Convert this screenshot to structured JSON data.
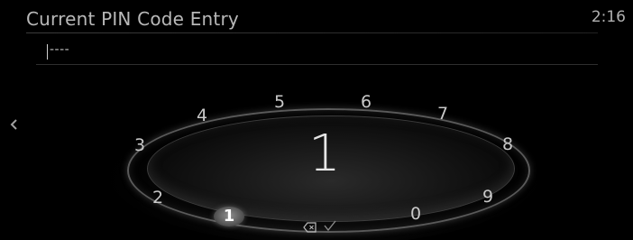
{
  "header": {
    "title": "Current PIN Code Entry",
    "clock": "2:16"
  },
  "entry": {
    "masked_value": "----"
  },
  "dial": {
    "selected_digit": "1",
    "keys": [
      "0",
      "1",
      "2",
      "3",
      "4",
      "5",
      "6",
      "7",
      "8",
      "9"
    ]
  },
  "icons": {
    "back": "chevron-left-icon",
    "backspace": "backspace-icon",
    "confirm": "checkmark-icon"
  }
}
